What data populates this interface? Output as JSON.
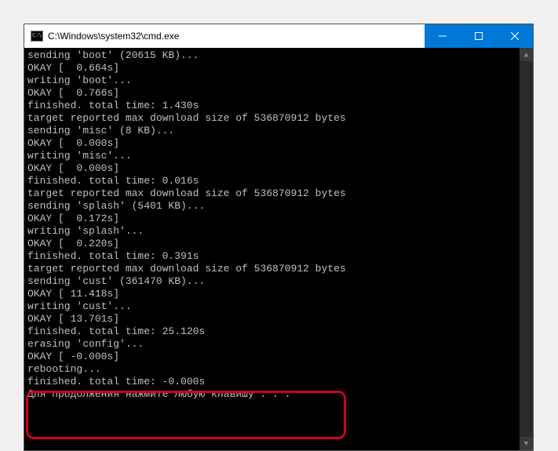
{
  "window": {
    "title": "C:\\Windows\\system32\\cmd.exe"
  },
  "terminal": {
    "lines": [
      "sending 'boot' (20615 KB)...",
      "OKAY [  0.664s]",
      "writing 'boot'...",
      "OKAY [  0.766s]",
      "finished. total time: 1.430s",
      "target reported max download size of 536870912 bytes",
      "sending 'misc' (8 KB)...",
      "OKAY [  0.000s]",
      "writing 'misc'...",
      "OKAY [  0.000s]",
      "finished. total time: 0.016s",
      "target reported max download size of 536870912 bytes",
      "sending 'splash' (5401 KB)...",
      "OKAY [  0.172s]",
      "writing 'splash'...",
      "OKAY [  0.220s]",
      "finished. total time: 0.391s",
      "target reported max download size of 536870912 bytes",
      "sending 'cust' (361470 KB)...",
      "OKAY [ 11.418s]",
      "writing 'cust'...",
      "OKAY [ 13.701s]",
      "finished. total time: 25.120s",
      "erasing 'config'...",
      "OKAY [ -0.000s]",
      "",
      "rebooting...",
      "",
      "finished. total time: -0.000s",
      "Для продолжения нажмите любую клавишу . . ."
    ]
  }
}
